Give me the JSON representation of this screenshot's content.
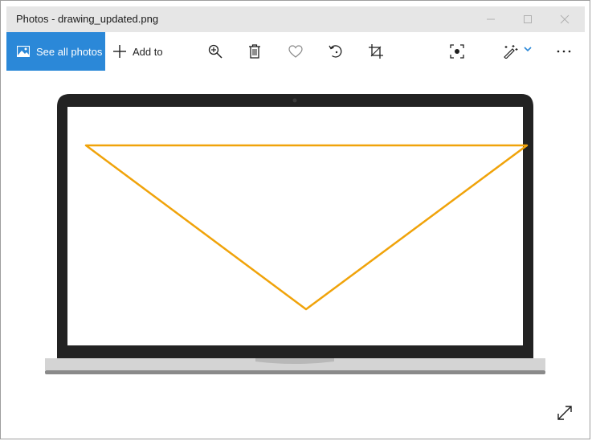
{
  "window": {
    "title": "Photos - drawing_updated.png"
  },
  "toolbar": {
    "see_all_label": "See all photos",
    "add_to_label": "Add to"
  },
  "icons": {
    "photos": "image-icon",
    "add": "plus-icon",
    "zoom": "zoom-in-icon",
    "delete": "trash-icon",
    "favorite": "heart-icon",
    "rotate": "rotate-icon",
    "crop": "crop-icon",
    "enhance": "enhance-icon",
    "edit": "edit-create-icon",
    "more": "more-icon",
    "expand": "expand-icon"
  },
  "colors": {
    "accent": "#2b88d8",
    "titlebar": "#e6e6e6",
    "triangle": "#f0a30a",
    "laptop_bezel": "#222222",
    "laptop_base": "#d4d4d4"
  }
}
